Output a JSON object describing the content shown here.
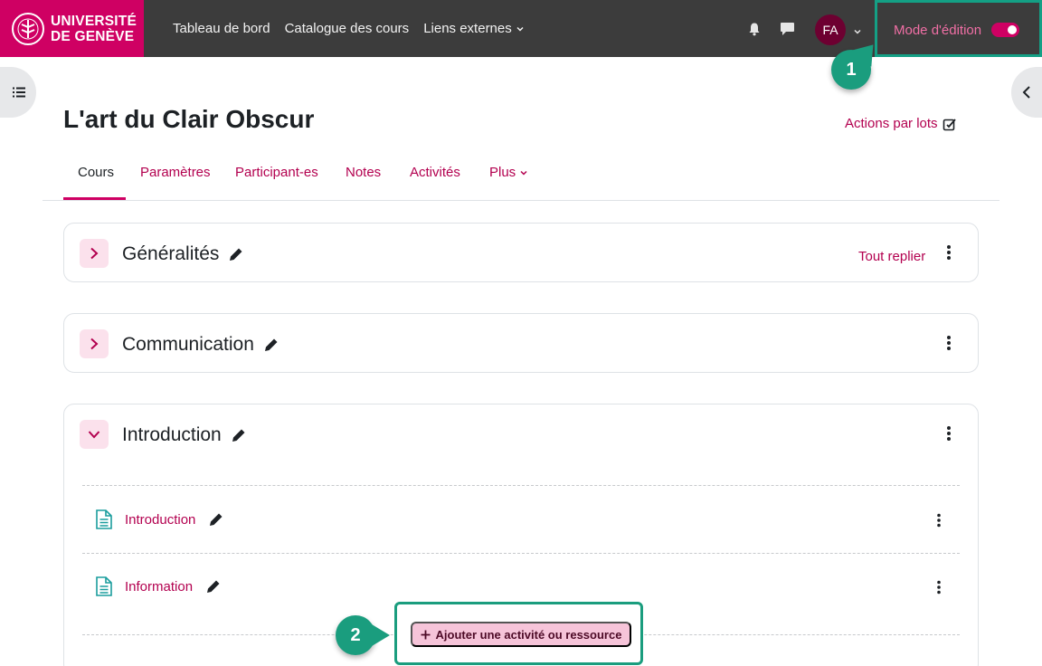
{
  "navbar": {
    "logo": {
      "line1": "UNIVERSITÉ",
      "line2": "DE GENÈVE"
    },
    "links": [
      {
        "label": "Tableau de bord"
      },
      {
        "label": "Catalogue des cours"
      },
      {
        "label": "Liens externes"
      }
    ],
    "user_initials": "FA",
    "edit_mode": {
      "label": "Mode d'édition",
      "enabled": true
    }
  },
  "callouts": {
    "first": "1",
    "second": "2"
  },
  "page": {
    "title": "L'art du Clair Obscur",
    "bulk_actions": "Actions par lots"
  },
  "tabs": [
    {
      "label": "Cours",
      "active": true
    },
    {
      "label": "Paramètres"
    },
    {
      "label": "Participant-es"
    },
    {
      "label": "Notes"
    },
    {
      "label": "Activités"
    },
    {
      "label": "Plus"
    }
  ],
  "sections": [
    {
      "title": "Généralités",
      "collapse_all": "Tout replier"
    },
    {
      "title": "Communication"
    },
    {
      "title": "Introduction",
      "activities": [
        {
          "name": "Introduction"
        },
        {
          "name": "Information"
        }
      ],
      "add_button": "Ajouter une activité ou ressource"
    }
  ],
  "colors": {
    "brand": "#cf0063",
    "navbar": "#3c3c3c",
    "link": "#b3004f",
    "callout": "#1a9d7e"
  }
}
